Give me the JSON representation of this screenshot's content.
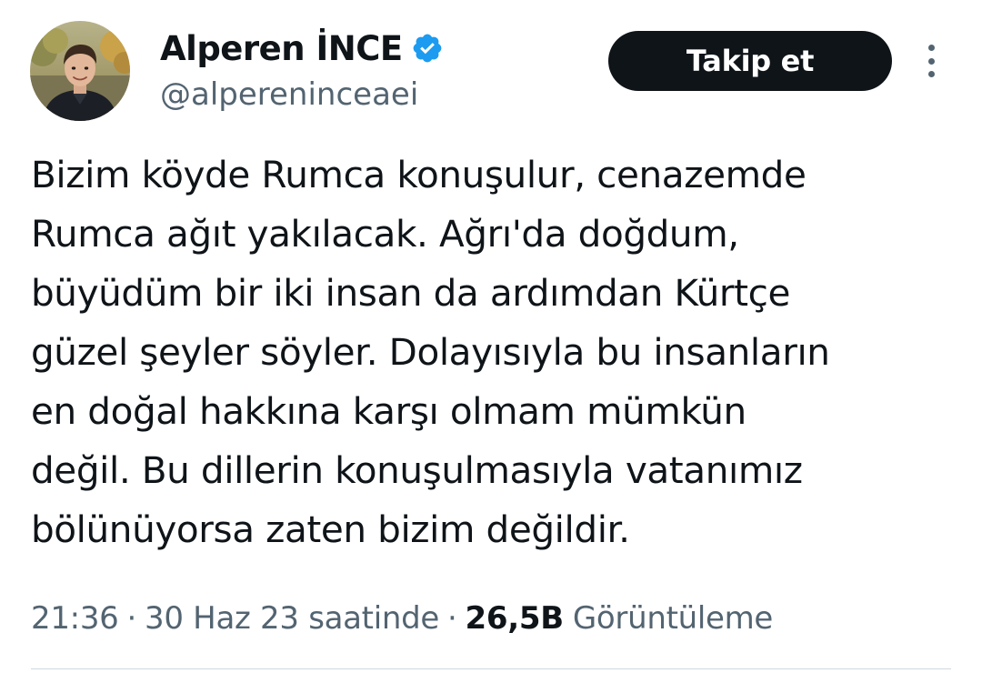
{
  "author": {
    "display_name": "Alperen İNCE",
    "handle": "@alpereninceaei",
    "verified": true,
    "verified_color": "#1d9bf0"
  },
  "actions": {
    "follow_label": "Takip et",
    "more_icon": "more-vertical-icon"
  },
  "tweet": {
    "text_lines": [
      "Bizim köyde Rumca konuşulur, cenazemde",
      "Rumca ağıt yakılacak. Ağrı'da doğdum,",
      "büyüdüm bir iki insan da ardımdan Kürtçe",
      "güzel şeyler söyler. Dolayısıyla bu insanların",
      "en doğal hakkına karşı olmam mümkün",
      "değil. Bu dillerin konuşulmasıyla vatanımız",
      "bölünüyorsa zaten bizim değildir."
    ]
  },
  "meta": {
    "time": "21:36",
    "separator": "·",
    "date": "30 Haz 23 saatinde",
    "views_count": "26,5B",
    "views_label": "Görüntüleme"
  },
  "colors": {
    "text": "#0f1419",
    "secondary": "#536471",
    "button_bg": "#0f1419",
    "button_text": "#ffffff",
    "divider": "#cfd9de"
  }
}
